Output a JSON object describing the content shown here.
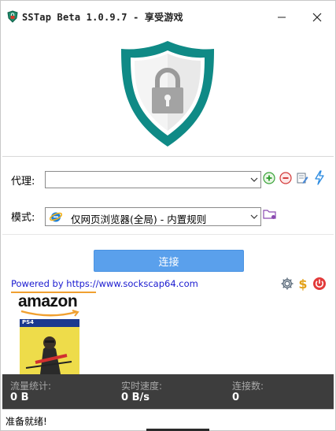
{
  "window": {
    "title": "SSTap Beta 1.0.9.7 - 享受游戏"
  },
  "icons": {
    "app": "app-shield-icon",
    "minimize": "minimize-icon",
    "close": "close-icon",
    "shield": "lock-shield-icon",
    "add": "add-proxy-icon",
    "remove": "remove-proxy-icon",
    "edit": "edit-proxy-icon",
    "speed": "lightning-icon",
    "mode_browser": "ie-browser-icon",
    "mode_folder": "rules-folder-icon",
    "settings": "gear-icon",
    "donate": "dollar-icon",
    "power": "power-icon"
  },
  "settings": {
    "proxy_label": "代理:",
    "proxy_value": "",
    "mode_label": "模式:",
    "mode_value": "仅网页浏览器(全局) - 内置规则"
  },
  "actions": {
    "connect_label": "连接"
  },
  "footer": {
    "powered_by": "Powered by https://www.sockscap64.com"
  },
  "ad": {
    "brand": "amazon",
    "badge": "PS4"
  },
  "stats": {
    "traffic_label": "流量统计:",
    "traffic_value": "0 B",
    "speed_label": "实时速度:",
    "speed_value": "0 B/s",
    "connections_label": "连接数:",
    "connections_value": "0"
  },
  "status": {
    "text": "准备就绪!"
  },
  "colors": {
    "shield_teal": "#0f8a86",
    "connect_button": "#5aa0ec",
    "stats_bg": "#3d3d3d",
    "link_blue": "#1a1ad0"
  }
}
